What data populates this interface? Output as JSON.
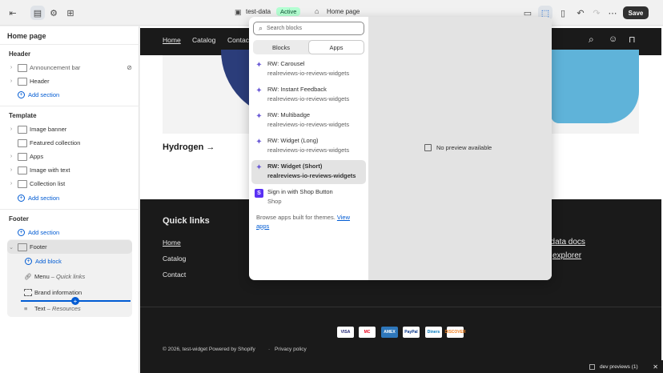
{
  "topbar": {
    "store_name": "test-data",
    "status": "Active",
    "page_name": "Home page",
    "save_label": "Save"
  },
  "sidebar": {
    "title": "Home page",
    "header_section": {
      "title": "Header",
      "items": [
        "Announcement bar",
        "Header"
      ],
      "add": "Add section"
    },
    "template_section": {
      "title": "Template",
      "items": [
        "Image banner",
        "Featured collection",
        "Apps",
        "Image with text",
        "Collection list"
      ],
      "add": "Add section"
    },
    "footer_section": {
      "title": "Footer",
      "add": "Add section",
      "footer_label": "Footer",
      "add_block": "Add block",
      "blocks": [
        {
          "label": "Menu",
          "sub": "Quick links"
        },
        {
          "label": "Brand information",
          "sub": ""
        },
        {
          "label": "Text",
          "sub": "Resources"
        }
      ]
    }
  },
  "preview": {
    "nav": [
      "Home",
      "Catalog",
      "Contact"
    ],
    "hydrogen": "Hydrogen →",
    "no_preview": "No preview available",
    "quick_links_title": "Quick links",
    "quick_links": [
      "Home",
      "Catalog",
      "Contact"
    ],
    "right_links": [
      "st data docs",
      "explorer"
    ],
    "payments": [
      "VISA",
      "MC",
      "AMEX",
      "PayPal",
      "Diners",
      "DISCOVER"
    ],
    "copyright": "© 2026, test-widget Powered by Shopify",
    "sep": "·",
    "privacy": "Privacy policy"
  },
  "popover": {
    "search_placeholder": "Search blocks",
    "tabs": [
      "Blocks",
      "Apps"
    ],
    "apps": [
      {
        "title": "RW: Carousel",
        "sub": "realreviews-io-reviews-widgets"
      },
      {
        "title": "RW: Instant Feedback",
        "sub": "realreviews-io-reviews-widgets"
      },
      {
        "title": "RW: Multibadge",
        "sub": "realreviews-io-reviews-widgets"
      },
      {
        "title": "RW: Widget (Long)",
        "sub": "realreviews-io-reviews-widgets"
      },
      {
        "title": "RW: Widget (Short)",
        "sub": "realreviews-io-reviews-widgets"
      },
      {
        "title": "Sign in with Shop Button",
        "sub": "Shop"
      }
    ],
    "browse_text": "Browse apps built for themes.",
    "view_apps": "View apps"
  },
  "dev_previews": "dev previews (1)",
  "colors": {
    "accent": "#005bd3",
    "active_bg": "#b4fed2",
    "dark": "#1a1a1a"
  }
}
